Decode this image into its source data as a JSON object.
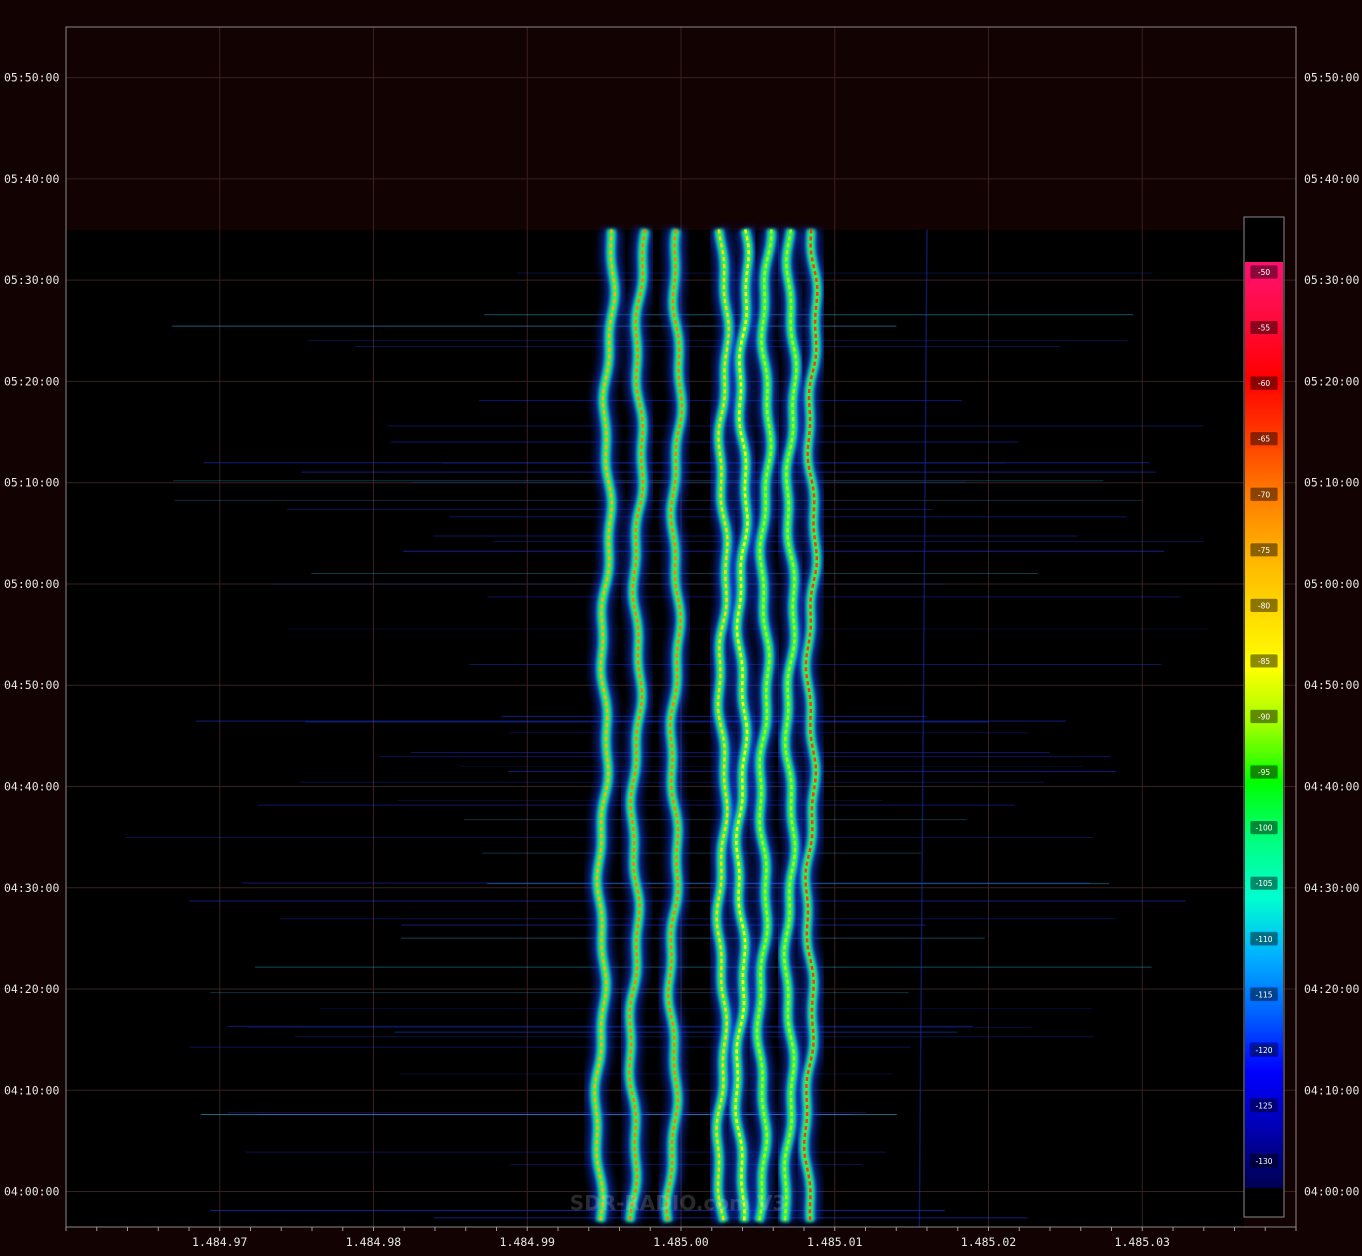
{
  "chart_data": {
    "type": "heatmap",
    "watermark": "SDR-RADIO.com V3",
    "x_ticks": [
      "1.484.97",
      "1.484.98",
      "1.484.99",
      "1.485.00",
      "1.485.01",
      "1.485.02",
      "1.485.03"
    ],
    "x_tick_values": [
      1484.97,
      1484.98,
      1484.99,
      1485.0,
      1485.01,
      1485.02,
      1485.03
    ],
    "xlim": [
      1484.96,
      1485.04
    ],
    "y_ticks": [
      "05:50:00",
      "05:40:00",
      "05:30:00",
      "05:20:00",
      "05:10:00",
      "05:00:00",
      "04:50:00",
      "04:40:00",
      "04:30:00",
      "04:20:00",
      "04:10:00",
      "04:00:00"
    ],
    "y_tick_minutes": [
      350,
      340,
      330,
      320,
      310,
      300,
      290,
      280,
      270,
      260,
      250,
      240
    ],
    "ylim_minutes": [
      236.5,
      355
    ],
    "data_end_minute": 335,
    "grid": true,
    "colorbar": {
      "labels": [
        "-50",
        "-55",
        "-60",
        "-65",
        "-70",
        "-75",
        "-80",
        "-85",
        "-90",
        "-95",
        "-100",
        "-105",
        "-110",
        "-115",
        "-120",
        "-125",
        "-130"
      ],
      "values": [
        -50,
        -55,
        -60,
        -65,
        -70,
        -75,
        -80,
        -85,
        -90,
        -95,
        -100,
        -105,
        -110,
        -115,
        -120,
        -125,
        -130
      ],
      "colors": [
        "#ff1070",
        "#ff0a3c",
        "#ff0000",
        "#ff3a00",
        "#ff7a00",
        "#ffb000",
        "#ffd800",
        "#ffff00",
        "#a0ff00",
        "#00ff00",
        "#00ff80",
        "#00ffd0",
        "#00b0ff",
        "#0060ff",
        "#0000ff",
        "#0000b0",
        "#000050"
      ]
    },
    "signal_traces": [
      {
        "freq": 1484.9954,
        "drift": -0.0008,
        "strength": -75
      },
      {
        "freq": 1484.9974,
        "drift": -0.0006,
        "strength": -68
      },
      {
        "freq": 1484.9998,
        "drift": -0.0004,
        "strength": -70
      },
      {
        "freq": 1485.0028,
        "drift": -0.0002,
        "strength": -82
      },
      {
        "freq": 1485.0041,
        "drift": -0.0003,
        "strength": -85
      },
      {
        "freq": 1485.0056,
        "drift": -0.0004,
        "strength": -92
      },
      {
        "freq": 1485.0072,
        "drift": -0.0002,
        "strength": -88
      },
      {
        "freq": 1485.0086,
        "drift": -0.0003,
        "strength": -66
      }
    ]
  }
}
